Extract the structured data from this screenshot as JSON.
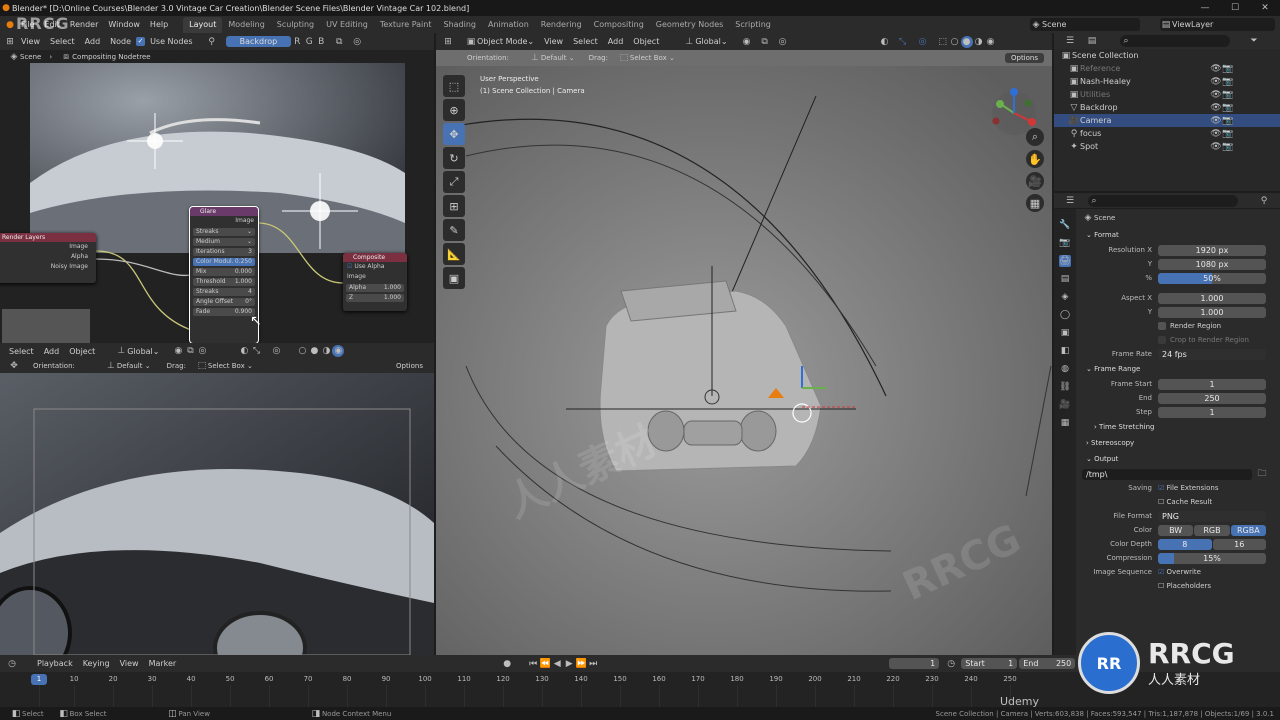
{
  "window": {
    "title": "Blender* [D:\\Online Courses\\Blender 3.0 Vintage Car Creation\\Blender Scene Files\\Blender Vintage Car 102.blend]"
  },
  "topmenu": [
    "File",
    "Edit",
    "Render",
    "Window",
    "Help"
  ],
  "workspaces": [
    "Layout",
    "Modeling",
    "Sculpting",
    "UV Editing",
    "Texture Paint",
    "Shading",
    "Animation",
    "Rendering",
    "Compositing",
    "Geometry Nodes",
    "Scripting"
  ],
  "scene_field": "Scene",
  "viewlayer_field": "ViewLayer",
  "node_editor": {
    "menus": [
      "View",
      "Select",
      "Add",
      "Node"
    ],
    "use_nodes": "Use Nodes",
    "backdrop": "Backdrop",
    "breadcrumb_scene": "Scene",
    "breadcrumb_tree": "Compositing Nodetree"
  },
  "nodes": {
    "render_layers": {
      "title": "Render Layers",
      "outputs": [
        "Image",
        "Alpha",
        "Noisy Image"
      ]
    },
    "glare": {
      "title": "Glare",
      "out": "Image",
      "type": "Streaks",
      "quality": "Medium",
      "fields": [
        [
          "Iterations",
          "3"
        ],
        [
          "Color Modul.",
          "0.250"
        ],
        [
          "Mix",
          "0.000"
        ],
        [
          "Threshold",
          "1.000"
        ],
        [
          "Streaks",
          "4"
        ],
        [
          "Angle Offset",
          "0°"
        ],
        [
          "Fade",
          "0.900"
        ]
      ]
    },
    "composite": {
      "title": "Composite",
      "use_alpha": "Use Alpha",
      "in": "Image",
      "alpha": [
        "Alpha",
        "1.000"
      ],
      "z": [
        "Z",
        "1.000"
      ]
    }
  },
  "vp2": {
    "menus": [
      "Select",
      "Add",
      "Object"
    ],
    "orientation_label": "Orientation:",
    "orientation": "Default",
    "drag_label": "Drag:",
    "drag": "Select Box",
    "transform": "Global",
    "options": "Options"
  },
  "vp": {
    "mode": "Object Mode",
    "menus": [
      "View",
      "Select",
      "Add",
      "Object"
    ],
    "transform": "Global",
    "orientation_label": "Orientation:",
    "orientation": "Default",
    "drag_label": "Drag:",
    "drag": "Select Box",
    "options": "Options",
    "perspective": "User Perspective",
    "collection": "(1) Scene Collection | Camera"
  },
  "outliner": {
    "root": "Scene Collection",
    "items": [
      {
        "name": "Reference",
        "dim": true
      },
      {
        "name": "Nash-Healey",
        "dim": false
      },
      {
        "name": "Utilities",
        "dim": true
      },
      {
        "name": "Backdrop",
        "dim": false
      },
      {
        "name": "Camera",
        "dim": false,
        "sel": true
      },
      {
        "name": "focus",
        "dim": false
      },
      {
        "name": "Spot",
        "dim": false
      }
    ]
  },
  "props": {
    "context": "Scene",
    "format": {
      "title": "Format",
      "res_x_label": "Resolution X",
      "res_x": "1920 px",
      "y_label": "Y",
      "res_y": "1080 px",
      "pct_label": "%",
      "pct": "50%",
      "aspect_x_label": "Aspect X",
      "aspect_x": "1.000",
      "aspect_y_label": "Y",
      "aspect_y": "1.000",
      "render_region": "Render Region",
      "crop": "Crop to Render Region",
      "frame_rate_label": "Frame Rate",
      "frame_rate": "24 fps"
    },
    "frame_range": {
      "title": "Frame Range",
      "start_label": "Frame Start",
      "start": "1",
      "end_label": "End",
      "end": "250",
      "step_label": "Step",
      "step": "1"
    },
    "time_stretching": "Time Stretching",
    "stereoscopy": "Stereoscopy",
    "output": {
      "title": "Output",
      "path": "/tmp\\",
      "saving_label": "Saving",
      "file_ext": "File Extensions",
      "cache": "Cache Result",
      "file_format_label": "File Format",
      "file_format": "PNG",
      "color_label": "Color",
      "colors": [
        "BW",
        "RGB",
        "RGBA"
      ],
      "depth_label": "Color Depth",
      "depths": [
        "8",
        "16"
      ],
      "compression_label": "Compression",
      "compression": "15%",
      "seq_label": "Image Sequence",
      "overwrite": "Overwrite",
      "placeholders": "Placeholders"
    }
  },
  "timeline": {
    "menus": [
      "Playback",
      "Keying",
      "View",
      "Marker"
    ],
    "current": "1",
    "start_label": "Start",
    "start": "1",
    "end_label": "End",
    "end": "250",
    "ticks": [
      "1",
      "10",
      "20",
      "30",
      "40",
      "50",
      "60",
      "70",
      "80",
      "90",
      "100",
      "110",
      "120",
      "130",
      "140",
      "150",
      "160",
      "170",
      "180",
      "190",
      "200",
      "210",
      "220",
      "230",
      "240",
      "250"
    ]
  },
  "status": {
    "select": "Select",
    "box": "Box Select",
    "pan": "Pan View",
    "ctx": "Node Context Menu",
    "right": "Scene Collection | Camera | Verts:603,838 | Faces:593,547 | Tris:1,187,878 | Objects:1/69 | 3.0.1"
  },
  "watermarks": {
    "rrcg": "RRCG",
    "cn": "人人素材",
    "udemy": "Udemy"
  }
}
